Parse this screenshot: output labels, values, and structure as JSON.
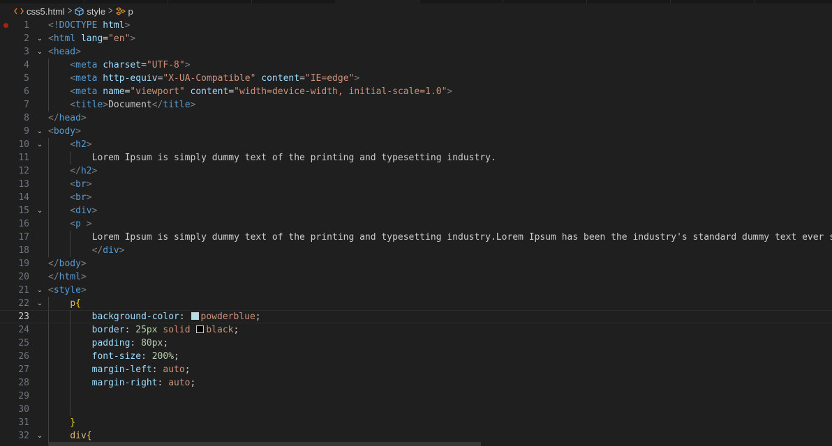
{
  "breadcrumb": {
    "file": "css5.html",
    "element1": "style",
    "element2": "p",
    "file_icon": "html-angle-brackets-icon",
    "element1_icon": "cube-symbol-icon",
    "element2_icon": "tag-symbol-icon"
  },
  "editor": {
    "current_line": "23",
    "lines": [
      {
        "n": "1",
        "tokens": [
          [
            "b",
            "<!"
          ],
          [
            "t",
            "DOCTYPE"
          ],
          [
            "tx",
            " "
          ],
          [
            "a",
            "html"
          ],
          [
            "b",
            ">"
          ]
        ],
        "indent": 0,
        "breakpoint": true
      },
      {
        "n": "2",
        "fold": true,
        "tokens": [
          [
            "b",
            "<"
          ],
          [
            "t",
            "html"
          ],
          [
            "tx",
            " "
          ],
          [
            "a",
            "lang"
          ],
          [
            "tx",
            "="
          ],
          [
            "s",
            "\"en\""
          ],
          [
            "b",
            ">"
          ]
        ],
        "indent": 0
      },
      {
        "n": "3",
        "fold": true,
        "tokens": [
          [
            "b",
            "<"
          ],
          [
            "t",
            "head"
          ],
          [
            "b",
            ">"
          ]
        ],
        "indent": 0
      },
      {
        "n": "4",
        "tokens": [
          [
            "tx",
            "    "
          ],
          [
            "b",
            "<"
          ],
          [
            "t",
            "meta"
          ],
          [
            "tx",
            " "
          ],
          [
            "a",
            "charset"
          ],
          [
            "tx",
            "="
          ],
          [
            "s",
            "\"UTF-8\""
          ],
          [
            "b",
            ">"
          ]
        ],
        "indent": 1
      },
      {
        "n": "5",
        "tokens": [
          [
            "tx",
            "    "
          ],
          [
            "b",
            "<"
          ],
          [
            "t",
            "meta"
          ],
          [
            "tx",
            " "
          ],
          [
            "a",
            "http-equiv"
          ],
          [
            "tx",
            "="
          ],
          [
            "s",
            "\"X-UA-Compatible\""
          ],
          [
            "tx",
            " "
          ],
          [
            "a",
            "content"
          ],
          [
            "tx",
            "="
          ],
          [
            "s",
            "\"IE=edge\""
          ],
          [
            "b",
            ">"
          ]
        ],
        "indent": 1
      },
      {
        "n": "6",
        "tokens": [
          [
            "tx",
            "    "
          ],
          [
            "b",
            "<"
          ],
          [
            "t",
            "meta"
          ],
          [
            "tx",
            " "
          ],
          [
            "a",
            "name"
          ],
          [
            "tx",
            "="
          ],
          [
            "s",
            "\"viewport\""
          ],
          [
            "tx",
            " "
          ],
          [
            "a",
            "content"
          ],
          [
            "tx",
            "="
          ],
          [
            "s",
            "\"width=device-width, initial-scale=1.0\""
          ],
          [
            "b",
            ">"
          ]
        ],
        "indent": 1
      },
      {
        "n": "7",
        "tokens": [
          [
            "tx",
            "    "
          ],
          [
            "b",
            "<"
          ],
          [
            "t",
            "title"
          ],
          [
            "b",
            ">"
          ],
          [
            "tx",
            "Document"
          ],
          [
            "b",
            "</"
          ],
          [
            "t",
            "title"
          ],
          [
            "b",
            ">"
          ]
        ],
        "indent": 1
      },
      {
        "n": "8",
        "tokens": [
          [
            "b",
            "</"
          ],
          [
            "t",
            "head"
          ],
          [
            "b",
            ">"
          ]
        ],
        "indent": 0
      },
      {
        "n": "9",
        "fold": true,
        "tokens": [
          [
            "b",
            "<"
          ],
          [
            "t",
            "body"
          ],
          [
            "b",
            ">"
          ]
        ],
        "indent": 0
      },
      {
        "n": "10",
        "fold": true,
        "tokens": [
          [
            "tx",
            "    "
          ],
          [
            "b",
            "<"
          ],
          [
            "t",
            "h2"
          ],
          [
            "b",
            ">"
          ]
        ],
        "indent": 1
      },
      {
        "n": "11",
        "tokens": [
          [
            "tx",
            "        Lorem Ipsum is simply dummy text of the printing and typesetting industry."
          ]
        ],
        "indent": 2
      },
      {
        "n": "12",
        "tokens": [
          [
            "tx",
            "    "
          ],
          [
            "b",
            "</"
          ],
          [
            "t",
            "h2"
          ],
          [
            "b",
            ">"
          ]
        ],
        "indent": 1
      },
      {
        "n": "13",
        "tokens": [
          [
            "tx",
            "    "
          ],
          [
            "b",
            "<"
          ],
          [
            "t",
            "br"
          ],
          [
            "b",
            ">"
          ]
        ],
        "indent": 1
      },
      {
        "n": "14",
        "tokens": [
          [
            "tx",
            "    "
          ],
          [
            "b",
            "<"
          ],
          [
            "t",
            "br"
          ],
          [
            "b",
            ">"
          ]
        ],
        "indent": 1
      },
      {
        "n": "15",
        "fold": true,
        "tokens": [
          [
            "tx",
            "    "
          ],
          [
            "b",
            "<"
          ],
          [
            "t",
            "div"
          ],
          [
            "b",
            ">"
          ]
        ],
        "indent": 1
      },
      {
        "n": "16",
        "tokens": [
          [
            "tx",
            "    "
          ],
          [
            "b",
            "<"
          ],
          [
            "t",
            "p"
          ],
          [
            "tx",
            " "
          ],
          [
            "b",
            ">"
          ]
        ],
        "indent": 1
      },
      {
        "n": "17",
        "tokens": [
          [
            "tx",
            "        Lorem Ipsum is simply dummy text of the printing and typesetting industry.Lorem Ipsum has been the industry's standard dummy text ever si"
          ]
        ],
        "indent": 2
      },
      {
        "n": "18",
        "tokens": [
          [
            "tx",
            "        "
          ],
          [
            "b",
            "</"
          ],
          [
            "t",
            "div"
          ],
          [
            "b",
            ">"
          ]
        ],
        "indent": 2
      },
      {
        "n": "19",
        "tokens": [
          [
            "b",
            "</"
          ],
          [
            "t",
            "body"
          ],
          [
            "b",
            ">"
          ]
        ],
        "indent": 0
      },
      {
        "n": "20",
        "tokens": [
          [
            "b",
            "</"
          ],
          [
            "t",
            "html"
          ],
          [
            "b",
            ">"
          ]
        ],
        "indent": 0
      },
      {
        "n": "21",
        "fold": true,
        "tokens": [
          [
            "b",
            "<"
          ],
          [
            "t",
            "style"
          ],
          [
            "b",
            ">"
          ]
        ],
        "indent": 0
      },
      {
        "n": "22",
        "fold": true,
        "tokens": [
          [
            "tx",
            "    "
          ],
          [
            "sel",
            "p"
          ],
          [
            "br",
            "{"
          ]
        ],
        "indent": 1
      },
      {
        "n": "23",
        "tokens": [
          [
            "tx",
            "        "
          ],
          [
            "prop",
            "background-color"
          ],
          [
            "tx",
            ": "
          ],
          [
            "swatch",
            "#b0e0e6"
          ],
          [
            "val",
            "powderblue"
          ],
          [
            "tx",
            ";"
          ]
        ],
        "indent": 2
      },
      {
        "n": "24",
        "tokens": [
          [
            "tx",
            "        "
          ],
          [
            "prop",
            "border"
          ],
          [
            "tx",
            ": "
          ],
          [
            "num",
            "25px"
          ],
          [
            "tx",
            " "
          ],
          [
            "val",
            "solid"
          ],
          [
            "tx",
            " "
          ],
          [
            "swatch",
            "#000000"
          ],
          [
            "val",
            "black"
          ],
          [
            "tx",
            ";"
          ]
        ],
        "indent": 2
      },
      {
        "n": "25",
        "tokens": [
          [
            "tx",
            "        "
          ],
          [
            "prop",
            "padding"
          ],
          [
            "tx",
            ": "
          ],
          [
            "num",
            "80px"
          ],
          [
            "tx",
            ";"
          ]
        ],
        "indent": 2
      },
      {
        "n": "26",
        "tokens": [
          [
            "tx",
            "        "
          ],
          [
            "prop",
            "font-size"
          ],
          [
            "tx",
            ": "
          ],
          [
            "num",
            "200%"
          ],
          [
            "tx",
            ";"
          ]
        ],
        "indent": 2
      },
      {
        "n": "27",
        "tokens": [
          [
            "tx",
            "        "
          ],
          [
            "prop",
            "margin-left"
          ],
          [
            "tx",
            ": "
          ],
          [
            "val",
            "auto"
          ],
          [
            "tx",
            ";"
          ]
        ],
        "indent": 2
      },
      {
        "n": "28",
        "tokens": [
          [
            "tx",
            "        "
          ],
          [
            "prop",
            "margin-right"
          ],
          [
            "tx",
            ": "
          ],
          [
            "val",
            "auto"
          ],
          [
            "tx",
            ";"
          ]
        ],
        "indent": 2
      },
      {
        "n": "29",
        "tokens": [],
        "indent": 2
      },
      {
        "n": "30",
        "tokens": [],
        "indent": 2
      },
      {
        "n": "31",
        "tokens": [
          [
            "tx",
            "    "
          ],
          [
            "br",
            "}"
          ]
        ],
        "indent": 1
      },
      {
        "n": "32",
        "fold": true,
        "tokens": [
          [
            "tx",
            "    "
          ],
          [
            "sel",
            "div"
          ],
          [
            "br",
            "{"
          ]
        ],
        "indent": 1
      }
    ]
  }
}
